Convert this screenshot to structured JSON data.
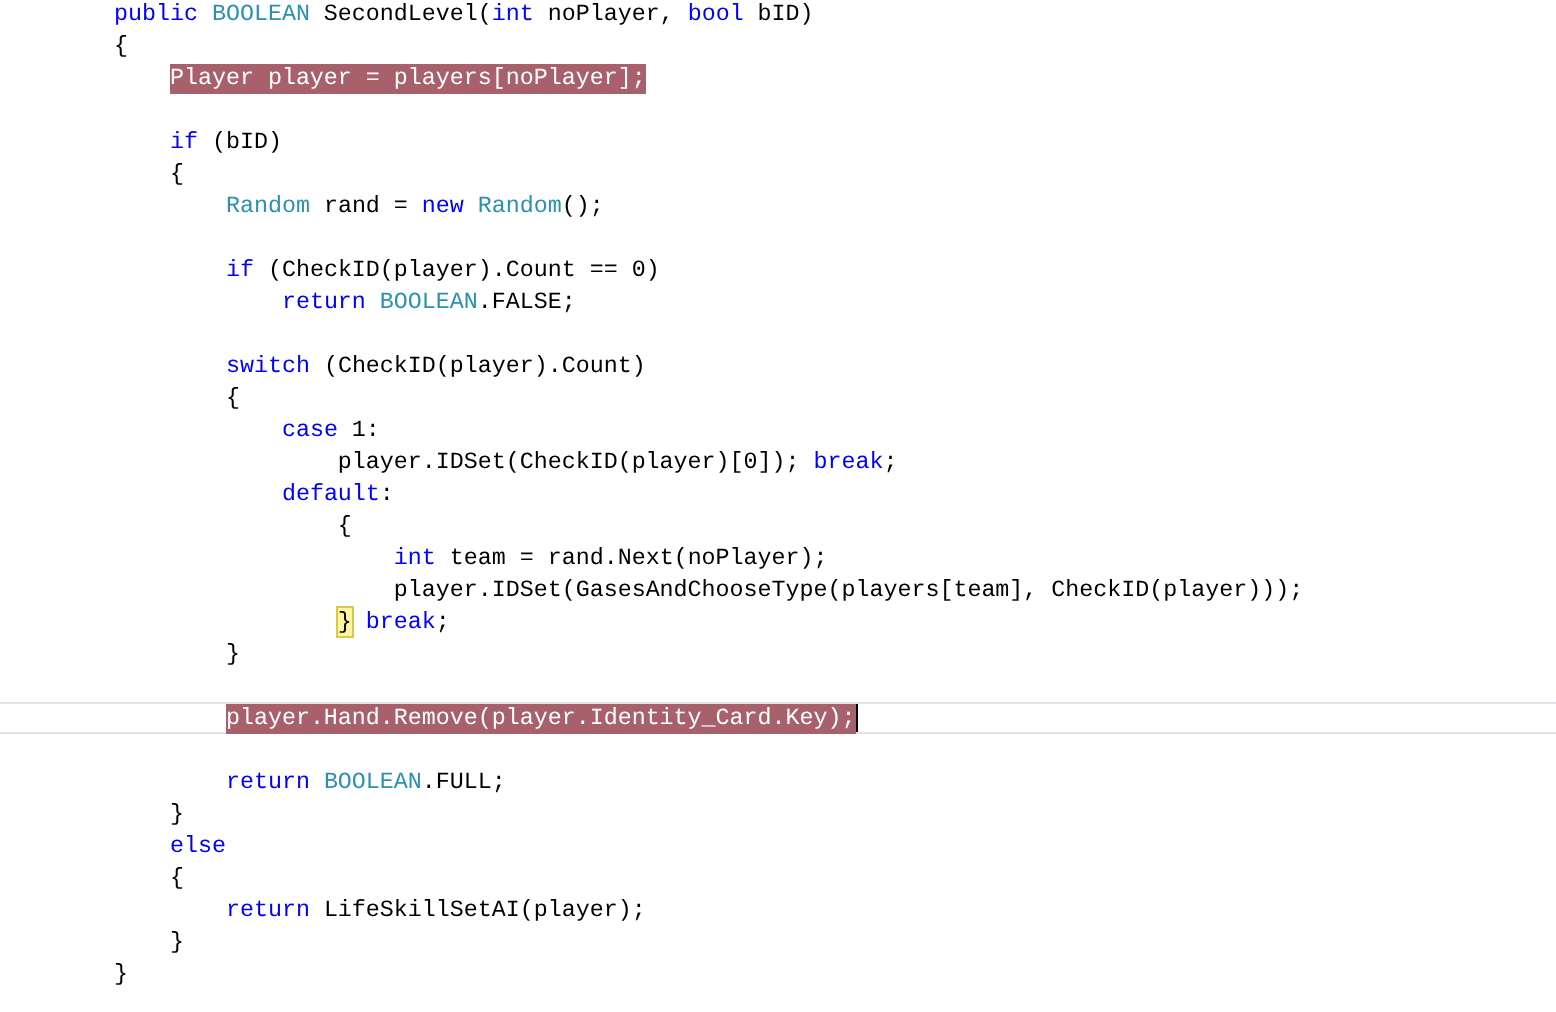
{
  "editor": {
    "lines": [
      {
        "tokens": [
          {
            "text": "public ",
            "kind": "keyword"
          },
          {
            "text": "BOOLEAN",
            "kind": "type"
          },
          {
            "text": " SecondLevel(",
            "kind": "plain"
          },
          {
            "text": "int",
            "kind": "keyword"
          },
          {
            "text": " noPlayer, ",
            "kind": "plain"
          },
          {
            "text": "bool",
            "kind": "keyword"
          },
          {
            "text": " bID)",
            "kind": "plain"
          }
        ],
        "highlighted": false,
        "current": false,
        "caret": false
      },
      {
        "tokens": [
          {
            "text": "{",
            "kind": "plain"
          }
        ],
        "highlighted": false,
        "current": false,
        "caret": false
      },
      {
        "tokens": [
          {
            "text": "    Player player = players[noPlayer];",
            "kind": "plain"
          }
        ],
        "highlighted": true,
        "current": false,
        "caret": false
      },
      {
        "highlighted": false,
        "current": false,
        "caret": false
      },
      {
        "tokens": [
          {
            "text": "    if",
            "kind": "keyword"
          },
          {
            "text": " (bID)",
            "kind": "plain"
          }
        ],
        "highlighted": false,
        "current": false,
        "caret": false
      },
      {
        "tokens": [
          {
            "text": "    {",
            "kind": "plain"
          }
        ],
        "highlighted": false,
        "current": false,
        "caret": false
      },
      {
        "tokens": [
          {
            "text": "        Random",
            "kind": "type"
          },
          {
            "text": " rand = ",
            "kind": "plain"
          },
          {
            "text": "new ",
            "kind": "keyword"
          },
          {
            "text": "Random",
            "kind": "type"
          },
          {
            "text": "();",
            "kind": "plain"
          }
        ],
        "highlighted": false,
        "current": false,
        "caret": false
      },
      {
        "highlighted": false,
        "current": false,
        "caret": false
      },
      {
        "tokens": [
          {
            "text": "        if",
            "kind": "keyword"
          },
          {
            "text": " (CheckID(player).Count == 0)",
            "kind": "plain"
          }
        ],
        "highlighted": false,
        "current": false,
        "caret": false
      },
      {
        "tokens": [
          {
            "text": "            return ",
            "kind": "keyword"
          },
          {
            "text": "BOOLEAN",
            "kind": "type"
          },
          {
            "text": ".FALSE;",
            "kind": "plain"
          }
        ],
        "highlighted": false,
        "current": false,
        "caret": false
      },
      {
        "highlighted": false,
        "current": false,
        "caret": false
      },
      {
        "tokens": [
          {
            "text": "        switch",
            "kind": "keyword"
          },
          {
            "text": " (CheckID(player).Count)",
            "kind": "plain"
          }
        ],
        "highlighted": false,
        "current": false,
        "caret": false
      },
      {
        "tokens": [
          {
            "text": "        {",
            "kind": "plain"
          }
        ],
        "highlighted": false,
        "current": false,
        "caret": false
      },
      {
        "tokens": [
          {
            "text": "            case",
            "kind": "keyword"
          },
          {
            "text": " 1:",
            "kind": "plain"
          }
        ],
        "highlighted": false,
        "current": false,
        "caret": false
      },
      {
        "tokens": [
          {
            "text": "                player.IDSet(CheckID(player)[0]); ",
            "kind": "plain"
          },
          {
            "text": "break",
            "kind": "keyword"
          },
          {
            "text": ";",
            "kind": "plain"
          }
        ],
        "highlighted": false,
        "current": false,
        "caret": false
      },
      {
        "tokens": [
          {
            "text": "            default",
            "kind": "keyword"
          },
          {
            "text": ":",
            "kind": "plain"
          }
        ],
        "highlighted": false,
        "current": false,
        "caret": false
      },
      {
        "tokens": [
          {
            "text": "                {",
            "kind": "plain"
          }
        ],
        "highlighted": false,
        "current": false,
        "caret": false
      },
      {
        "tokens": [
          {
            "text": "                    int",
            "kind": "keyword"
          },
          {
            "text": " team = rand.Next(noPlayer);",
            "kind": "plain"
          }
        ],
        "highlighted": false,
        "current": false,
        "caret": false
      },
      {
        "tokens": [
          {
            "text": "                    player.IDSet(GasesAndChooseType(players[team], CheckID(player)));",
            "kind": "plain"
          }
        ],
        "highlighted": false,
        "current": false,
        "caret": false
      },
      {
        "tokens": [
          {
            "text": "                }",
            "kind": "brace_match"
          },
          {
            "text": " break",
            "kind": "keyword"
          },
          {
            "text": ";",
            "kind": "plain"
          }
        ],
        "highlighted": false,
        "current": false,
        "caret": false
      },
      {
        "tokens": [
          {
            "text": "        }",
            "kind": "plain"
          }
        ],
        "highlighted": false,
        "current": false,
        "caret": false
      },
      {
        "highlighted": false,
        "current": false,
        "caret": false
      },
      {
        "tokens": [
          {
            "text": "        player.Hand.Remove(player.Identity_Card.Key);",
            "kind": "plain"
          }
        ],
        "highlighted": true,
        "current": true,
        "caret": true
      },
      {
        "highlighted": false,
        "current": false,
        "caret": false
      },
      {
        "tokens": [
          {
            "text": "        return ",
            "kind": "keyword"
          },
          {
            "text": "BOOLEAN",
            "kind": "type"
          },
          {
            "text": ".FULL;",
            "kind": "plain"
          }
        ],
        "highlighted": false,
        "current": false,
        "caret": false
      },
      {
        "tokens": [
          {
            "text": "    }",
            "kind": "plain"
          }
        ],
        "highlighted": false,
        "current": false,
        "caret": false
      },
      {
        "tokens": [
          {
            "text": "    else",
            "kind": "keyword"
          }
        ],
        "highlighted": false,
        "current": false,
        "caret": false
      },
      {
        "tokens": [
          {
            "text": "    {",
            "kind": "plain"
          }
        ],
        "highlighted": false,
        "current": false,
        "caret": false
      },
      {
        "tokens": [
          {
            "text": "        return ",
            "kind": "keyword"
          },
          {
            "text": "LifeSkillSetAI(player);",
            "kind": "plain"
          }
        ],
        "highlighted": false,
        "current": false,
        "caret": false
      },
      {
        "tokens": [
          {
            "text": "    }",
            "kind": "plain"
          }
        ],
        "highlighted": false,
        "current": false,
        "caret": false
      },
      {
        "tokens": [
          {
            "text": "}",
            "kind": "plain"
          }
        ],
        "highlighted": false,
        "current": false,
        "caret": false
      }
    ]
  }
}
